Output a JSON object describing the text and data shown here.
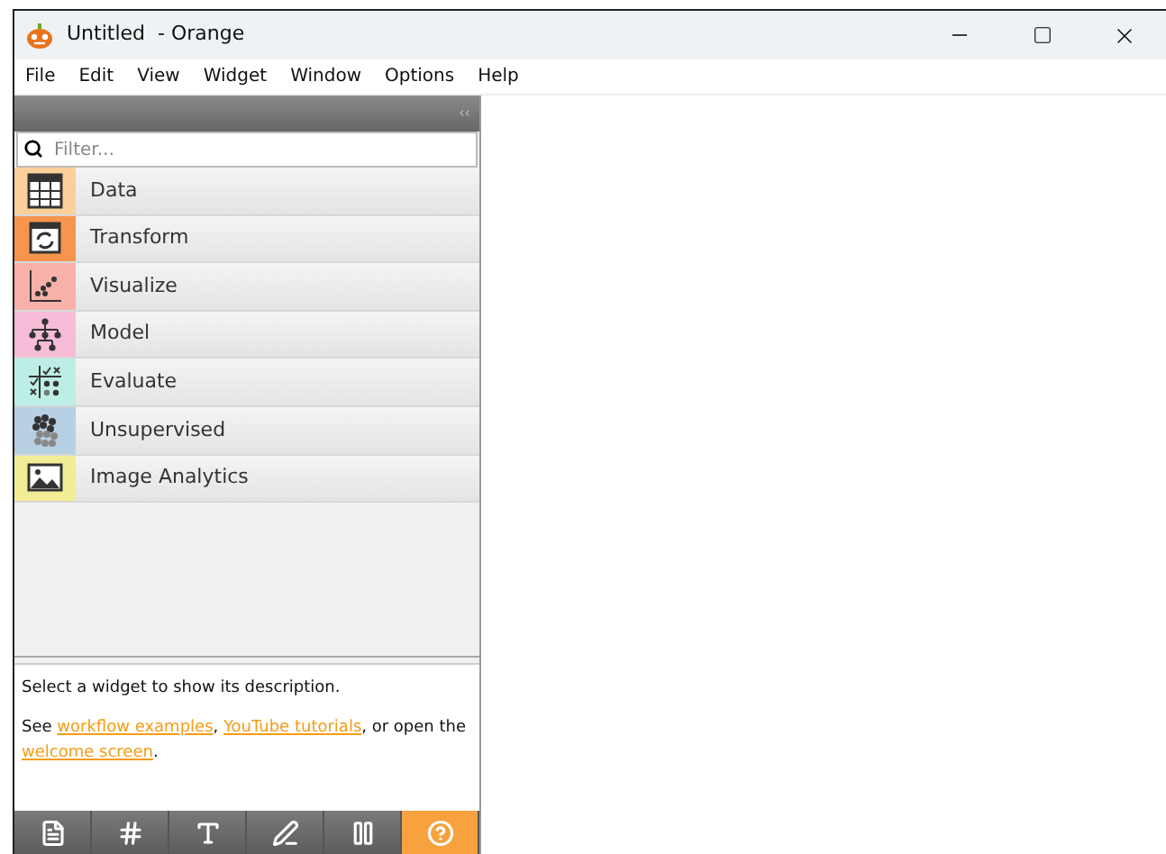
{
  "window": {
    "title": "Untitled  - Orange"
  },
  "menu": [
    "File",
    "Edit",
    "View",
    "Widget",
    "Window",
    "Options",
    "Help"
  ],
  "toolbox": {
    "collapse": "‹‹",
    "filter": {
      "placeholder": "Filter..."
    },
    "categories": [
      {
        "label": "Data",
        "color": "#fbd09b"
      },
      {
        "label": "Transform",
        "color": "#f7944d"
      },
      {
        "label": "Visualize",
        "color": "#f9b1aa"
      },
      {
        "label": "Model",
        "color": "#f6bcd8"
      },
      {
        "label": "Evaluate",
        "color": "#bdeee6"
      },
      {
        "label": "Unsupervised",
        "color": "#b7d0e4"
      },
      {
        "label": "Image Analytics",
        "color": "#f3ec96"
      }
    ]
  },
  "description": {
    "text": "Select a widget to show its description.",
    "parts": [
      {
        "text": "See ",
        "link": false
      },
      {
        "text": "workflow examples",
        "link": true
      },
      {
        "text": ", ",
        "link": false
      },
      {
        "text": "YouTube tutorials",
        "link": true
      },
      {
        "text": ", or open the ",
        "link": false
      },
      {
        "text": "welcome screen",
        "link": true
      },
      {
        "text": ".",
        "link": false
      }
    ]
  },
  "tools": [
    {
      "kind": "info",
      "on": false
    },
    {
      "kind": "grid",
      "on": false
    },
    {
      "kind": "text",
      "on": false
    },
    {
      "kind": "pen",
      "on": false
    },
    {
      "kind": "pause",
      "on": false
    },
    {
      "kind": "help",
      "on": true
    }
  ]
}
